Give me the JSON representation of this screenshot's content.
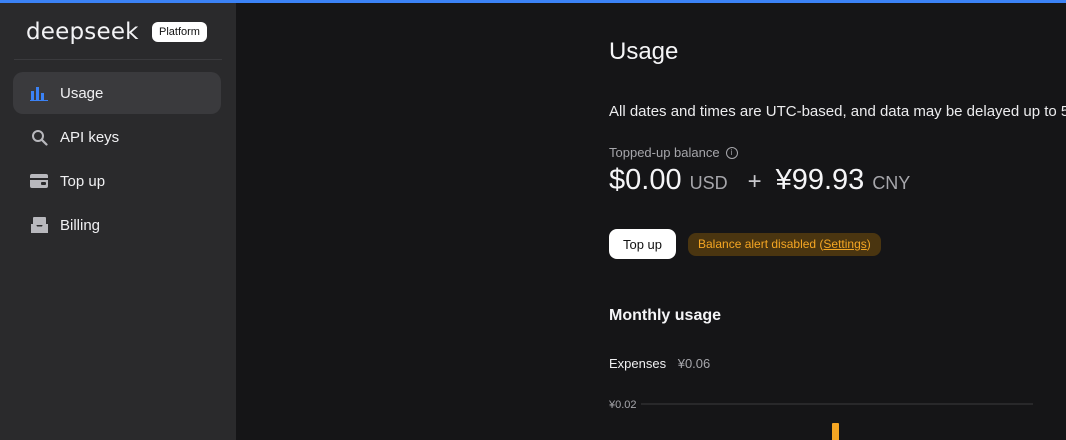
{
  "brand": {
    "logo": "deepseek",
    "badge": "Platform"
  },
  "sidebar": {
    "items": [
      {
        "label": "Usage",
        "icon": "bar-chart-icon",
        "active": true
      },
      {
        "label": "API keys",
        "icon": "search-icon",
        "active": false
      },
      {
        "label": "Top up",
        "icon": "wallet-icon",
        "active": false
      },
      {
        "label": "Billing",
        "icon": "inbox-icon",
        "active": false
      }
    ]
  },
  "main": {
    "title": "Usage",
    "notice": "All dates and times are UTC-based, and data may be delayed up to 5",
    "balance": {
      "label": "Topped-up balance",
      "usd_amount": "$0.00",
      "usd_unit": "USD",
      "plus": "+",
      "cny_amount": "¥99.93",
      "cny_unit": "CNY"
    },
    "topup_button": "Top up",
    "alert": {
      "prefix": "Balance alert disabled (",
      "link": "Settings",
      "suffix": ")"
    },
    "monthly_usage": {
      "title": "Monthly usage",
      "expenses_label": "Expenses",
      "expenses_value": "¥0.06"
    }
  },
  "chart_data": {
    "type": "bar",
    "y_ticks": [
      "¥0.02"
    ],
    "values": [
      0.02
    ],
    "bar_color": "#f5a623",
    "grid": true
  },
  "colors": {
    "accent": "#3b82f6",
    "alert_bg": "#4a3510",
    "alert_text": "#f5a623"
  }
}
